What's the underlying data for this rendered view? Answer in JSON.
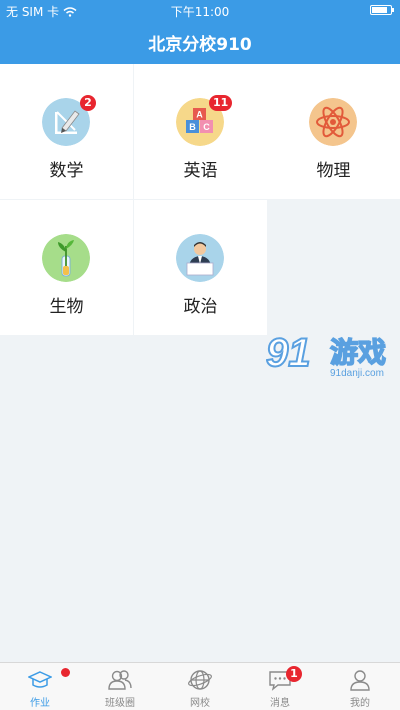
{
  "status_bar": {
    "carrier": "无 SIM 卡",
    "time": "下午11:00",
    "battery_level": 0.85
  },
  "header": {
    "title": "北京分校910"
  },
  "subjects": [
    {
      "label": "数学",
      "icon": "math-icon",
      "badge": "2"
    },
    {
      "label": "英语",
      "icon": "abc-blocks-icon",
      "badge": "11"
    },
    {
      "label": "物理",
      "icon": "atom-icon",
      "badge": null
    },
    {
      "label": "生物",
      "icon": "plant-icon",
      "badge": null
    },
    {
      "label": "政治",
      "icon": "speaker-podium-icon",
      "badge": null
    }
  ],
  "watermark": {
    "logo": "91游戏",
    "url": "91danji.com"
  },
  "tabbar": {
    "tabs": [
      {
        "label": "作业",
        "icon": "graduation-cap-icon",
        "active": true,
        "badge": ""
      },
      {
        "label": "班级圈",
        "icon": "people-icon",
        "active": false,
        "badge": null
      },
      {
        "label": "网校",
        "icon": "globe-icon",
        "active": false,
        "badge": null
      },
      {
        "label": "消息",
        "icon": "chat-bubble-icon",
        "active": false,
        "badge": "1"
      },
      {
        "label": "我的",
        "icon": "person-icon",
        "active": false,
        "badge": null
      }
    ]
  },
  "colors": {
    "primary": "#3b9be6",
    "badge": "#e8262f",
    "background": "#eff3f6"
  }
}
